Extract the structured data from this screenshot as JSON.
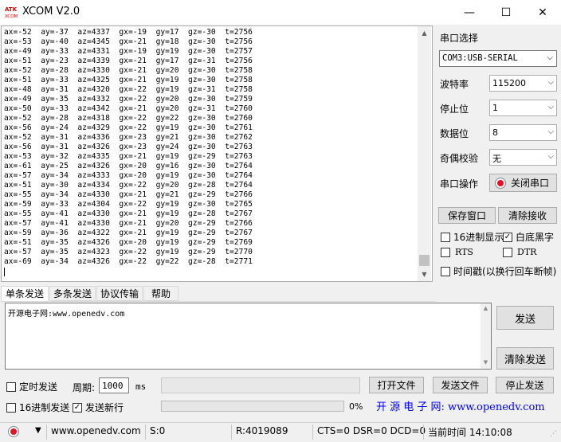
{
  "window": {
    "title": "XCOM V2.0",
    "logo_text": "ATK XCOM",
    "minimize": "—",
    "maximize": "☐",
    "close": "✕"
  },
  "receive": {
    "lines": [
      "ax=-52  ay=-37  az=4337  gx=-19  gy=17  gz=-30  t=2756",
      "ax=-53  ay=-40  az=4345  gx=-21  gy=18  gz=-30  t=2756",
      "ax=-49  ay=-33  az=4331  gx=-19  gy=19  gz=-30  t=2757",
      "ax=-51  ay=-23  az=4339  gx=-21  gy=17  gz=-31  t=2756",
      "ax=-52  ay=-28  az=4330  gx=-21  gy=20  gz=-30  t=2758",
      "ax=-51  ay=-33  az=4325  gx=-21  gy=19  gz=-30  t=2758",
      "ax=-48  ay=-31  az=4320  gx=-22  gy=19  gz=-31  t=2758",
      "ax=-49  ay=-35  az=4332  gx=-22  gy=20  gz=-30  t=2759",
      "ax=-50  ay=-33  az=4342  gx=-21  gy=20  gz=-31  t=2760",
      "ax=-52  ay=-28  az=4318  gx=-22  gy=22  gz=-30  t=2760",
      "ax=-56  ay=-24  az=4329  gx=-22  gy=19  gz=-30  t=2761",
      "ax=-52  ay=-31  az=4336  gx=-23  gy=21  gz=-30  t=2762",
      "ax=-56  ay=-31  az=4326  gx=-23  gy=24  gz=-30  t=2763",
      "ax=-53  ay=-32  az=4335  gx=-21  gy=19  gz=-29  t=2763",
      "ax=-61  ay=-25  az=4326  gx=-20  gy=16  gz=-30  t=2764",
      "ax=-57  ay=-34  az=4333  gx=-20  gy=19  gz=-30  t=2764",
      "ax=-51  ay=-30  az=4334  gx=-22  gy=20  gz=-28  t=2764",
      "ax=-55  ay=-34  az=4330  gx=-21  gy=21  gz=-29  t=2766",
      "ax=-59  ay=-33  az=4304  gx=-22  gy=19  gz=-30  t=2765",
      "ax=-55  ay=-41  az=4330  gx=-21  gy=19  gz=-28  t=2767",
      "ax=-57  ay=-41  az=4330  gx=-21  gy=20  gz=-29  t=2766",
      "ax=-59  ay=-36  az=4322  gx=-21  gy=19  gz=-29  t=2767",
      "ax=-51  ay=-35  az=4326  gx=-20  gy=19  gz=-29  t=2769",
      "ax=-57  ay=-35  az=4323  gx=-22  gy=19  gz=-29  t=2770",
      "ax=-69  ay=-34  az=4326  gx=-22  gy=22  gz=-28  t=2771"
    ]
  },
  "serial": {
    "port_label": "串口选择",
    "port_value": "COM3:USB-SERIAL",
    "baud_label": "波特率",
    "baud_value": "115200",
    "stop_label": "停止位",
    "stop_value": "1",
    "data_label": "数据位",
    "data_value": "8",
    "parity_label": "奇偶校验",
    "parity_value": "无",
    "op_label": "串口操作",
    "op_button": "关闭串口"
  },
  "panel": {
    "save_window": "保存窗口",
    "clear_receive": "清除接收",
    "hex_display": "16进制显示",
    "white_bg": "白底黑字",
    "rts": "RTS",
    "dtr": "DTR",
    "timestamp": "时间戳(以换行回车断帧)"
  },
  "tabs": [
    "单条发送",
    "多条发送",
    "协议传输",
    "帮助"
  ],
  "send": {
    "text": "开源电子网:www.openedv.com",
    "send_button": "发送",
    "clear_send": "清除发送",
    "timed_send": "定时发送",
    "period_label": "周期:",
    "period_value": "1000",
    "period_unit": "ms",
    "open_file": "打开文件",
    "send_file": "发送文件",
    "stop_send": "停止发送",
    "hex_send": "16进制发送",
    "send_newline": "发送新行",
    "progress": "0%",
    "ad_text": "开 源 电 子 网: www.openedv.com"
  },
  "status": {
    "website": "www.openedv.com",
    "sent": "S:0",
    "received": "R:4019089",
    "lines": "CTS=0 DSR=0 DCD=0",
    "time": "当前时间 14:10:08"
  },
  "colors": {
    "accent": "#0000ff",
    "record": "#e81123"
  }
}
